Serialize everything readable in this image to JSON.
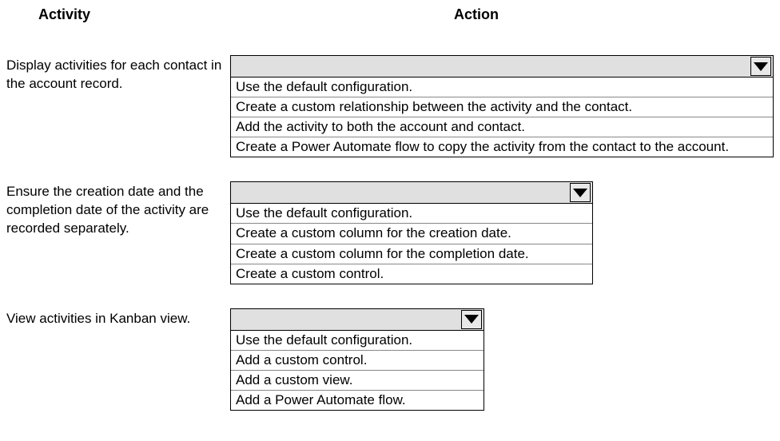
{
  "headers": {
    "activity": "Activity",
    "action": "Action"
  },
  "rows": [
    {
      "activity": "Display activities for each contact in the account record.",
      "options": [
        "Use the default configuration.",
        "Create a custom relationship between the activity and the contact.",
        "Add the activity to both the account and contact.",
        "Create a Power Automate flow to copy the activity from the contact to the account."
      ]
    },
    {
      "activity": "Ensure the creation date and the completion date of the activity are recorded separately.",
      "options": [
        "Use the default configuration.",
        "Create a custom column for the creation date.",
        "Create a custom column for the completion date.",
        "Create a custom control."
      ]
    },
    {
      "activity": "View activities in Kanban view.",
      "options": [
        "Use the default configuration.",
        "Add a custom control.",
        "Add a custom view.",
        "Add a Power Automate flow."
      ]
    }
  ]
}
